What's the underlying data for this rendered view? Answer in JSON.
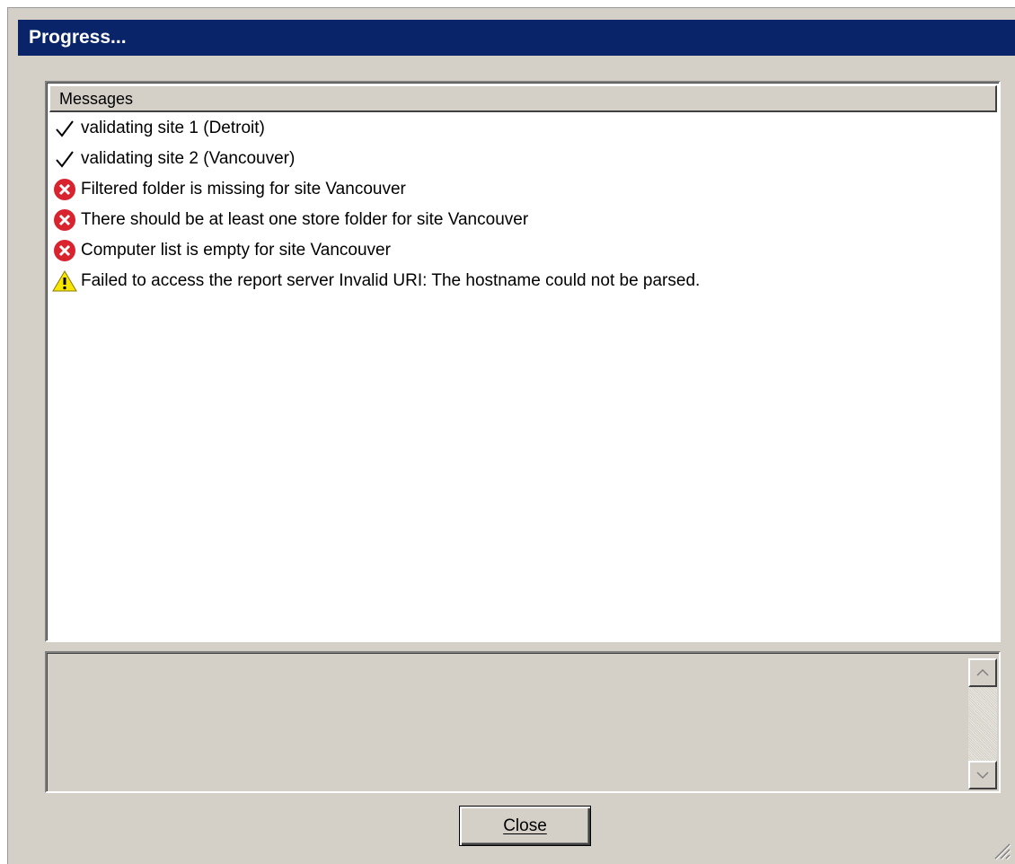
{
  "window": {
    "title": "Progress..."
  },
  "messages": {
    "column_header": "Messages",
    "rows": [
      {
        "icon": "check-icon",
        "text": "validating site 1 (Detroit)"
      },
      {
        "icon": "check-icon",
        "text": "validating site 2 (Vancouver)"
      },
      {
        "icon": "error-icon",
        "text": "Filtered folder is missing for site Vancouver"
      },
      {
        "icon": "error-icon",
        "text": "There should be at least one store folder for site Vancouver"
      },
      {
        "icon": "error-icon",
        "text": "Computer list is empty for site Vancouver"
      },
      {
        "icon": "warning-icon",
        "text": "Failed to access the report server Invalid URI: The hostname could not be parsed."
      }
    ]
  },
  "buttons": {
    "close_label": "Close"
  },
  "colors": {
    "title_bar": "#0a246a",
    "dialog_face": "#d4d0c8",
    "error": "#d9232e",
    "warning": "#f7e600"
  }
}
